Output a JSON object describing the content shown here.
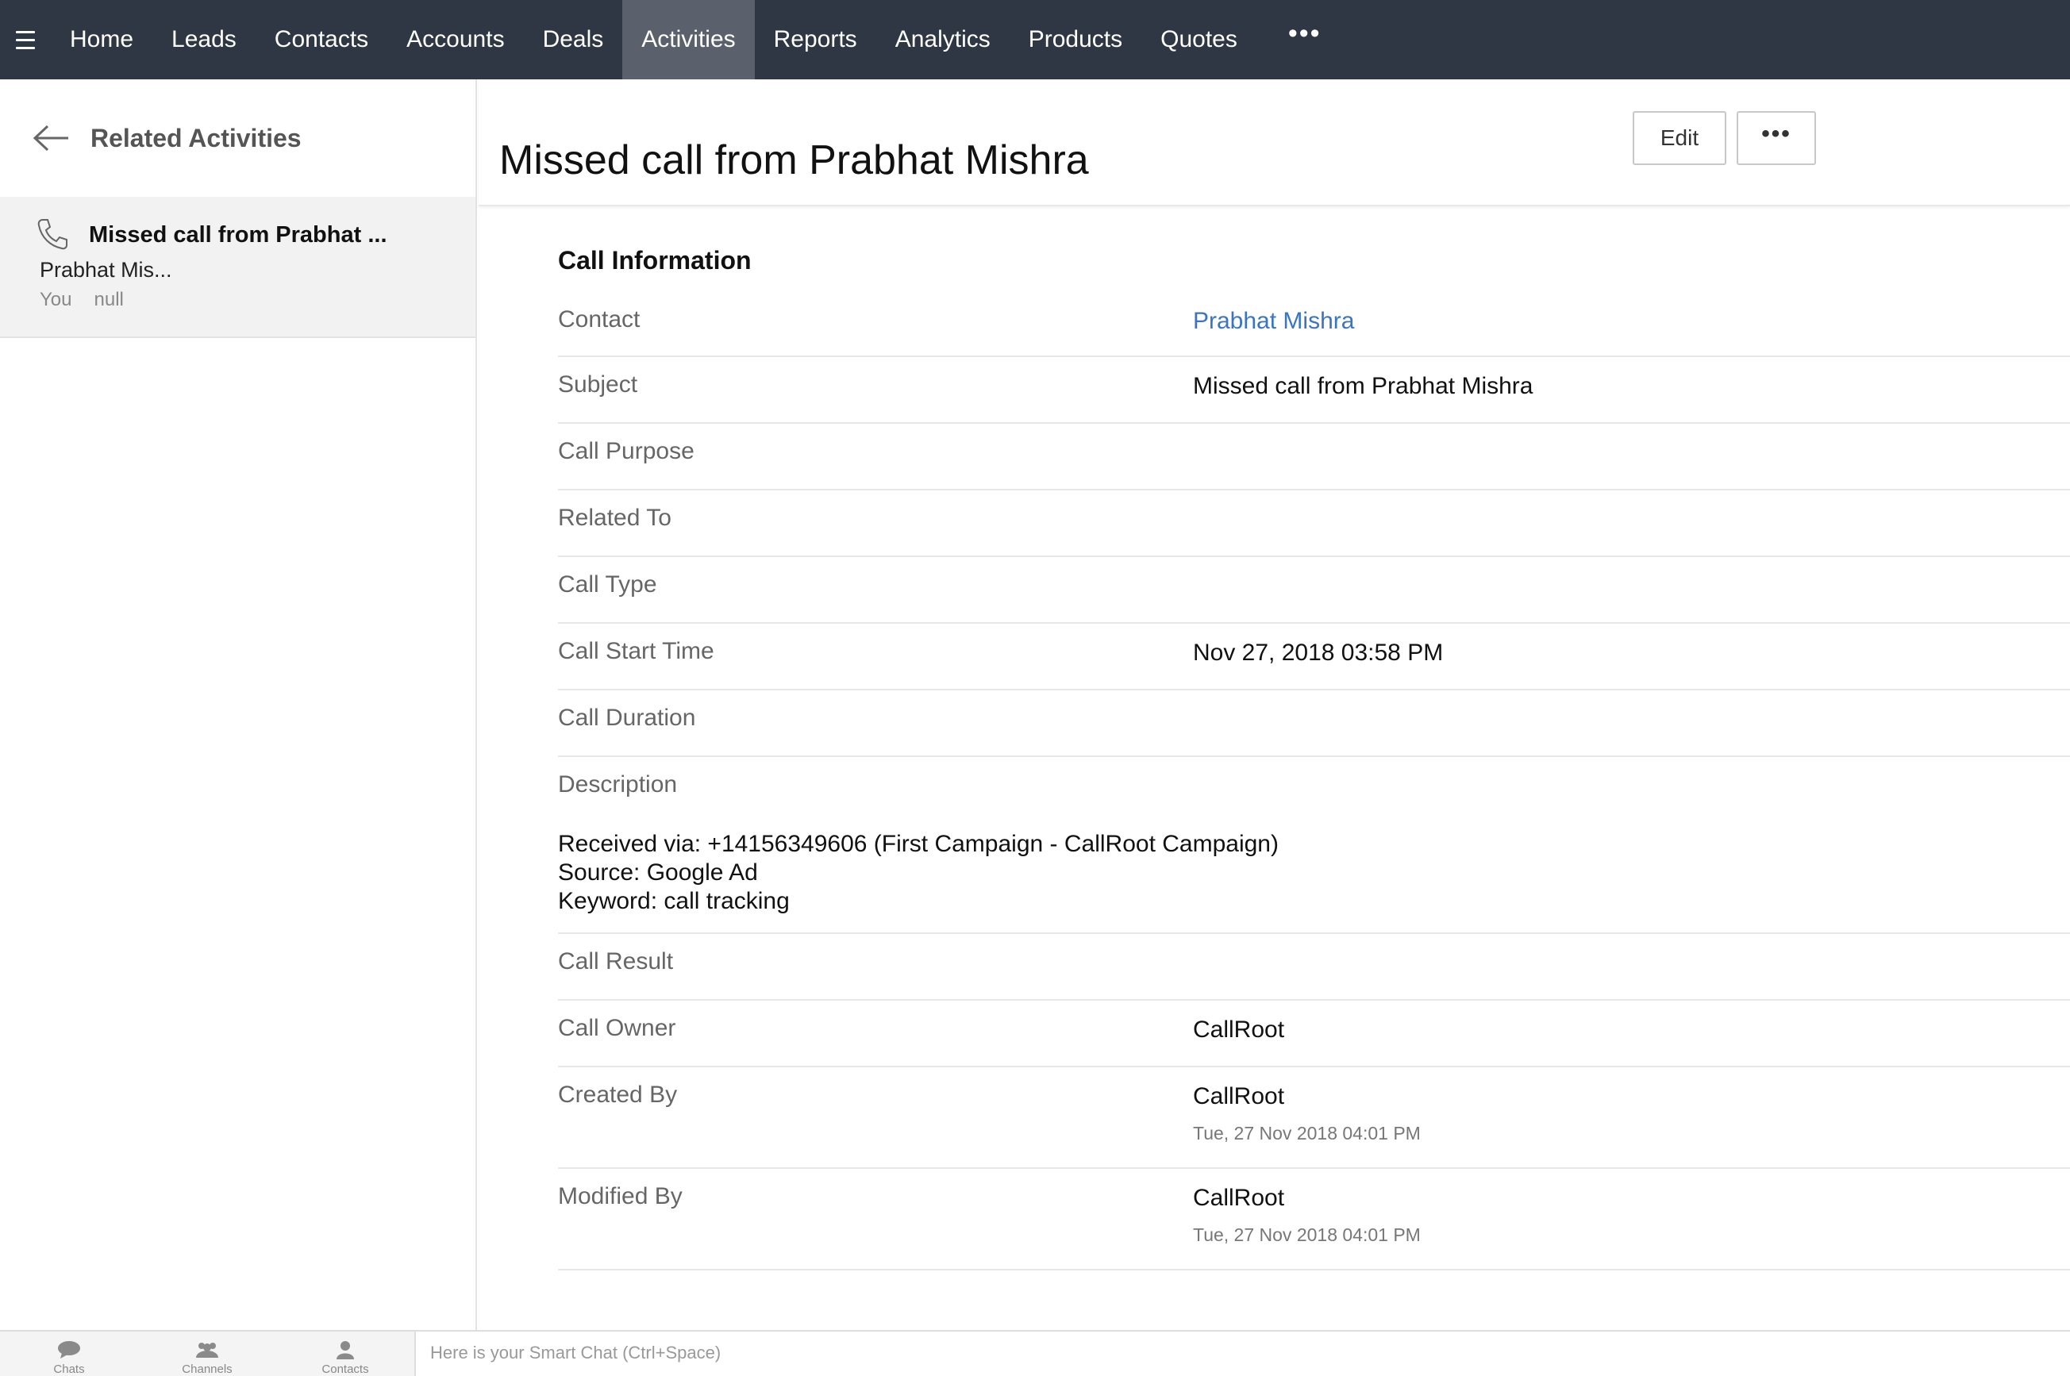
{
  "nav": {
    "items": [
      "Home",
      "Leads",
      "Contacts",
      "Accounts",
      "Deals",
      "Activities",
      "Reports",
      "Analytics",
      "Products",
      "Quotes"
    ],
    "active": "Activities",
    "more": "•••"
  },
  "sidebar": {
    "title": "Related Activities",
    "item": {
      "title": "Missed call from Prabhat ...",
      "subtitle": "Prabhat Mis...",
      "owner": "You",
      "extra": "null"
    }
  },
  "header": {
    "title": "Missed call from Prabhat Mishra",
    "edit_label": "Edit",
    "more_label": "•••"
  },
  "call_info": {
    "title": "Call Information",
    "contact_label": "Contact",
    "contact_value": "Prabhat Mishra",
    "subject_label": "Subject",
    "subject_value": "Missed call from Prabhat Mishra",
    "purpose_label": "Call Purpose",
    "related_label": "Related To",
    "type_label": "Call Type",
    "start_label": "Call Start Time",
    "start_value": "Nov 27, 2018 03:58 PM",
    "duration_label": "Call Duration",
    "description_label": "Description",
    "description_lines": [
      "Received via: +14156349606 (First Campaign - CallRoot Campaign)",
      "Source: Google Ad",
      "Keyword: call tracking"
    ],
    "result_label": "Call Result",
    "owner_label": "Call Owner",
    "owner_value": "CallRoot",
    "created_label": "Created By",
    "created_value": "CallRoot",
    "created_time": "Tue, 27 Nov 2018 04:01 PM",
    "modified_label": "Modified By",
    "modified_value": "CallRoot",
    "modified_time": "Tue, 27 Nov 2018 04:01 PM"
  },
  "bottombar": {
    "tabs": [
      "Chats",
      "Channels",
      "Contacts"
    ],
    "smart_chat_placeholder": "Here is your Smart Chat (Ctrl+Space)"
  },
  "colors": {
    "nav_bg": "#2f3744",
    "nav_active": "#5a616c",
    "link": "#3a75c4"
  }
}
